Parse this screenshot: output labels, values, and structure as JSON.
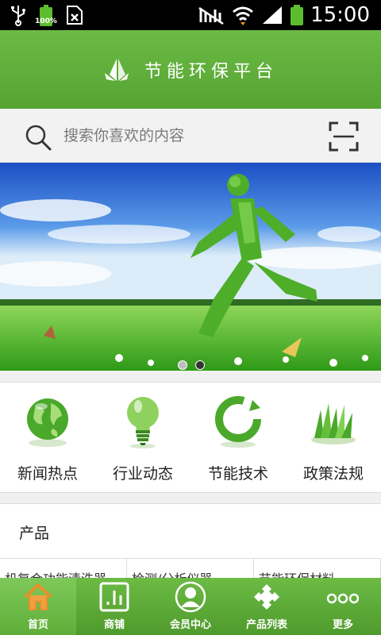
{
  "status_bar": {
    "time": "15:00",
    "battery_small_label": "100%"
  },
  "header": {
    "title": "节能环保平台"
  },
  "search": {
    "placeholder": "搜索你喜欢的内容"
  },
  "banner": {
    "slide_count": 2,
    "active_slide": 2
  },
  "categories": [
    {
      "label": "新闻热点",
      "icon": "globe-icon"
    },
    {
      "label": "行业动态",
      "icon": "lightbulb-icon"
    },
    {
      "label": "节能技术",
      "icon": "recycle-icon"
    },
    {
      "label": "政策法规",
      "icon": "grass-icon"
    }
  ],
  "products": {
    "title": "产品",
    "tabs": [
      "机复合功能清洗器",
      "检测/分析仪器",
      "节能环保材料"
    ]
  },
  "bottom_nav": [
    {
      "label": "首页",
      "icon": "home-icon",
      "active": true
    },
    {
      "label": "商铺",
      "icon": "shop-icon",
      "active": false
    },
    {
      "label": "会员中心",
      "icon": "member-icon",
      "active": false
    },
    {
      "label": "产品列表",
      "icon": "puzzle-icon",
      "active": false
    },
    {
      "label": "更多",
      "icon": "more-icon",
      "active": false
    }
  ],
  "colors": {
    "brand_green": "#5dae38",
    "status_bar": "#000000"
  }
}
